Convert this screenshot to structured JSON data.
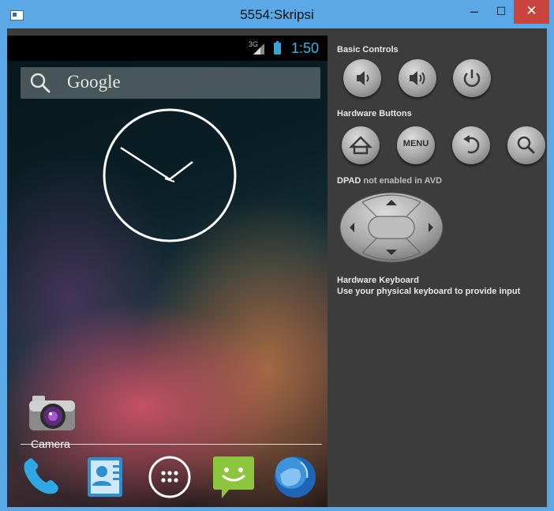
{
  "window": {
    "title": "5554:Skripsi",
    "controls": {
      "minimize": "–",
      "maximize": "☐",
      "close": "✕"
    }
  },
  "device": {
    "status": {
      "network": "3G",
      "time": "1:50"
    },
    "search": {
      "label": "Google"
    },
    "apps": [
      {
        "name": "Camera",
        "icon": "camera-icon"
      }
    ],
    "dock": [
      {
        "icon": "phone-icon"
      },
      {
        "icon": "contacts-icon"
      },
      {
        "icon": "apps-launcher-icon"
      },
      {
        "icon": "messaging-icon"
      },
      {
        "icon": "browser-globe-icon"
      }
    ]
  },
  "panel": {
    "basic_controls": {
      "title": "Basic Controls",
      "buttons": [
        "volume-down-icon",
        "volume-up-icon",
        "power-icon"
      ]
    },
    "hardware_buttons": {
      "title": "Hardware Buttons",
      "buttons": [
        "home-icon",
        "menu-icon",
        "back-icon",
        "search-icon"
      ],
      "menu_label": "MENU"
    },
    "dpad": {
      "title_bold": "DPAD",
      "title_rest": " not enabled in AVD"
    },
    "keyboard": {
      "title": "Hardware Keyboard",
      "hint": "Use your physical keyboard to provide input"
    }
  }
}
